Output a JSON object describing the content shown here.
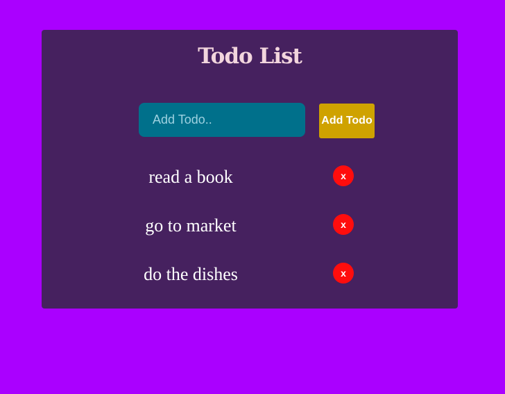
{
  "app": {
    "title": "Todo List"
  },
  "form": {
    "input_value": "",
    "input_placeholder": "Add Todo..",
    "add_label": "Add Todo"
  },
  "todos": [
    {
      "text": "read a book",
      "delete_label": "x"
    },
    {
      "text": "go to market",
      "delete_label": "x"
    },
    {
      "text": "do the dishes",
      "delete_label": "x"
    }
  ],
  "colors": {
    "page_background": "#aa00ff",
    "card_background": "#46215f",
    "title": "#f2d5dd",
    "input_background": "#00708b",
    "add_button": "#cfa200",
    "delete_button": "#ff0d0d"
  }
}
